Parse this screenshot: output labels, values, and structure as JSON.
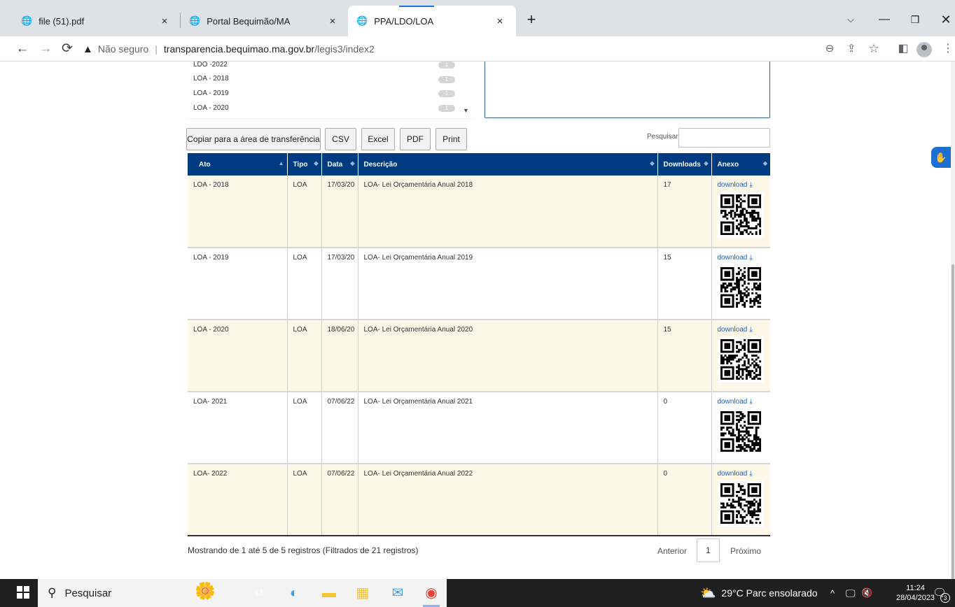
{
  "browser": {
    "tabs": [
      {
        "title": "file (51).pdf",
        "icon": "globe-icon",
        "close": "×"
      },
      {
        "title": "Portal Bequimão/MA",
        "icon": "globe-icon",
        "close": "×"
      },
      {
        "title": "PPA/LDO/LOA",
        "icon": "globe-icon",
        "close": "×"
      }
    ],
    "new_tab": "+",
    "address": {
      "warning": "Não seguro",
      "host": "transparencia.bequimao.ma.gov.br",
      "path": "/legis3/index2"
    }
  },
  "listbox": {
    "items": [
      {
        "label": "LDO -2022",
        "count": "1"
      },
      {
        "label": "LOA - 2018",
        "count": "1"
      },
      {
        "label": "LOA - 2019",
        "count": "1"
      },
      {
        "label": "LOA - 2020",
        "count": "1"
      }
    ]
  },
  "buttons": {
    "copy": "Copiar para a área de transferência",
    "csv": "CSV",
    "excel": "Excel",
    "pdf": "PDF",
    "print": "Print"
  },
  "search": {
    "label": "Pesquisar",
    "placeholder": ""
  },
  "table": {
    "headers": {
      "ato": "Ato",
      "tipo": "Tipo",
      "data": "Data",
      "descricao": "Descrição",
      "downloads": "Downloads",
      "anexo": "Anexo"
    },
    "rows": [
      {
        "ato": "LOA - 2018",
        "tipo": "LOA",
        "data": "17/03/20",
        "descricao": "LOA- Lei Orçamentária Anual 2018",
        "downloads": "17",
        "anexo": "download"
      },
      {
        "ato": "LOA - 2019",
        "tipo": "LOA",
        "data": "17/03/20",
        "descricao": "LOA- Lei Orçamentária Anual 2019",
        "downloads": "15",
        "anexo": "download"
      },
      {
        "ato": "LOA - 2020",
        "tipo": "LOA",
        "data": "18/06/20",
        "descricao": "LOA- Lei Orçamentária Anual 2020",
        "downloads": "15",
        "anexo": "download"
      },
      {
        "ato": "LOA- 2021",
        "tipo": "LOA",
        "data": "07/06/22",
        "descricao": "LOA- Lei Orçamentária Anual 2021",
        "downloads": "0",
        "anexo": "download"
      },
      {
        "ato": "LOA- 2022",
        "tipo": "LOA",
        "data": "07/06/22",
        "descricao": "LOA- Lei Orçamentária Anual 2022",
        "downloads": "0",
        "anexo": "download"
      }
    ]
  },
  "footer": {
    "info": "Mostrando de 1 até 5 de 5 registros (Filtrados de 21 registros)",
    "prev": "Anterior",
    "page": "1",
    "next": "Próximo"
  },
  "taskbar": {
    "search_label": "Pesquisar",
    "weather": "29°C  Parc ensolarado",
    "time": "11:24",
    "date": "28/04/2023",
    "notifications": "3"
  },
  "colors": {
    "header_bg": "#003a80",
    "odd_row": "#fcf7e6",
    "link": "#1f5fbf"
  }
}
